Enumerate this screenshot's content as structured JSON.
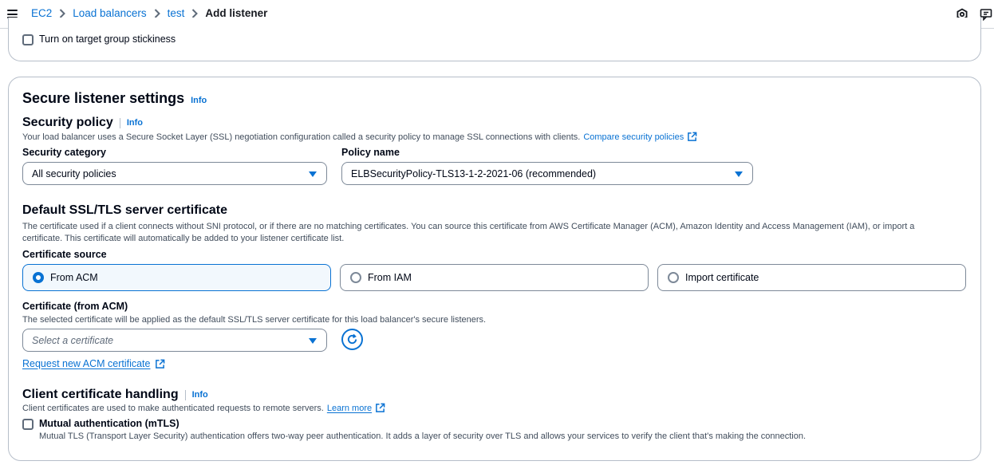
{
  "breadcrumb": {
    "items": [
      "EC2",
      "Load balancers",
      "test"
    ],
    "current": "Add listener"
  },
  "stickiness": {
    "label": "Turn on target group stickiness"
  },
  "secure_settings": {
    "title": "Secure listener settings",
    "info": "Info",
    "security_policy": {
      "title": "Security policy",
      "info": "Info",
      "description": "Your load balancer uses a Secure Socket Layer (SSL) negotiation configuration called a security policy to manage SSL connections with clients.",
      "compare_link": "Compare security policies",
      "category_label": "Security category",
      "category_value": "All security policies",
      "policy_label": "Policy name",
      "policy_value": "ELBSecurityPolicy-TLS13-1-2-2021-06 (recommended)"
    },
    "default_cert": {
      "title": "Default SSL/TLS server certificate",
      "description_line1": "The certificate used if a client connects without SNI protocol, or if there are no matching certificates. You can source this certificate from AWS Certificate Manager (ACM), Amazon Identity and Access Management (IAM), or import a",
      "description_line2": "certificate. This certificate will automatically be added to your listener certificate list.",
      "source_label": "Certificate source",
      "sources": [
        "From ACM",
        "From IAM",
        "Import certificate"
      ],
      "selected_source": "From ACM",
      "acm_label": "Certificate (from ACM)",
      "acm_description": "The selected certificate will be applied as the default SSL/TLS server certificate for this load balancer's secure listeners.",
      "acm_placeholder": "Select a certificate",
      "request_link": "Request new ACM certificate"
    },
    "client_cert": {
      "title": "Client certificate handling",
      "info": "Info",
      "description": "Client certificates are used to make authenticated requests to remote servers.",
      "learn_more": "Learn more",
      "mtls_label": "Mutual authentication (mTLS)",
      "mtls_description": "Mutual TLS (Transport Layer Security) authentication offers two-way peer authentication. It adds a layer of security over TLS and allows your services to verify the client that's making the connection."
    }
  },
  "icons": {
    "menu": "hamburger-menu-icon",
    "separator": "chevron-right-icon",
    "external": "external-link-icon",
    "refresh": "refresh-icon",
    "top_right": [
      "settings-icon",
      "feedback-icon"
    ]
  },
  "colors": {
    "accent": "#0972d3",
    "text": "#000716",
    "muted": "#414d5c",
    "border": "#b6bec9"
  }
}
